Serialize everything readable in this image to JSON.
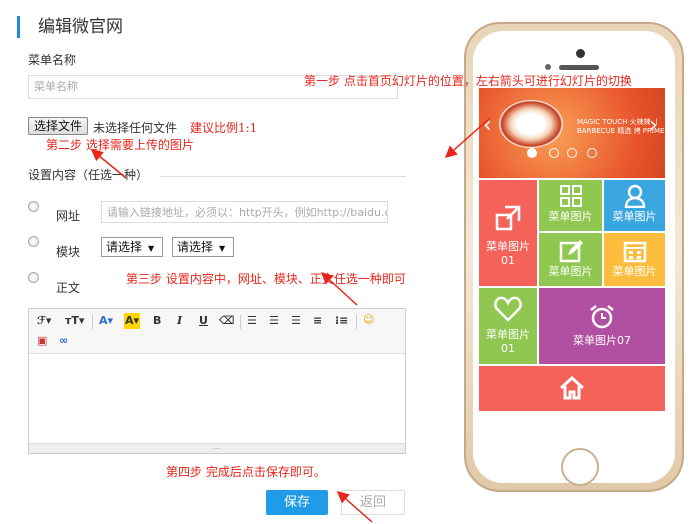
{
  "page": {
    "title": "编辑微官网"
  },
  "form": {
    "menu_name_label": "菜单名称",
    "menu_name_placeholder": "菜单名称",
    "file_button": "选择文件",
    "file_status": "未选择任何文件",
    "ratio_hint": "建议比例1:1",
    "content_label": "设置内容（任选一种）",
    "opt_url": "网址",
    "url_placeholder": "请输入链接地址，必须以：http开头，例如http://baidu.com",
    "opt_module": "模块",
    "select1": "请选择",
    "select2": "请选择",
    "opt_body": "正文",
    "save": "保存",
    "back": "返回"
  },
  "annotations": {
    "step1": "第一步  点击首页幻灯片的位置，左右箭头可进行幻灯片的切换",
    "step2": "第二步  选择需要上传的图片",
    "step3": "第三步  设置内容中，网址、模块、正文任选一种即可",
    "step4": "第四步  完成后点击保存即可。"
  },
  "phone": {
    "banner_text": "MAGIC TOUCH 火辣辣 丨 BARBECUE 精选 烤 PRIME",
    "tiles": [
      {
        "label": "菜单图片",
        "sub": "01",
        "icon": "share-icon",
        "color": "#f4625a"
      },
      {
        "label": "菜单图片",
        "sub": "",
        "icon": "grid-icon",
        "color": "#8fc750"
      },
      {
        "label": "菜单图片",
        "sub": "",
        "icon": "user-icon",
        "color": "#3aa6df"
      },
      {
        "label": "菜单图片",
        "sub": "",
        "icon": "edit-icon",
        "color": "#8fc750"
      },
      {
        "label": "菜单图片",
        "sub": "",
        "icon": "calendar-icon",
        "color": "#fcbc3d"
      },
      {
        "label": "菜单图片",
        "sub": "01",
        "icon": "heart-icon",
        "color": "#8fc750"
      },
      {
        "label": "菜单图片07",
        "sub": "",
        "icon": "alarm-icon",
        "color": "#b14fa0"
      },
      {
        "label": "",
        "sub": "",
        "icon": "home-icon",
        "color": "#f4625a"
      }
    ]
  },
  "colors": {
    "accent": "#1f9be8",
    "annotation": "#e8261b"
  }
}
